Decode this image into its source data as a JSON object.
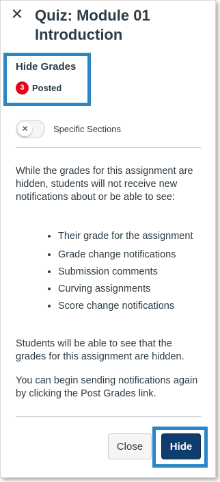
{
  "header": {
    "close_icon": "✕",
    "title": "Quiz: Module 01 Introduction"
  },
  "hide_grades": {
    "title": "Hide Grades",
    "posted_count": "3",
    "posted_label": "Posted"
  },
  "toggle": {
    "knob_icon": "✕",
    "label": "Specific Sections",
    "enabled": false
  },
  "content": {
    "intro": "While the grades for this assignment are hidden, students will not receive new notifications about or be able to see:",
    "bullets": [
      "Their grade for the assignment",
      "Grade change notifications",
      "Submission comments",
      "Curving assignments",
      "Score change notifications"
    ],
    "para2": "Students will be able to see that the grades for this assignment are hidden.",
    "para3": "You can begin sending notifications again by clicking the Post Grades link."
  },
  "footer": {
    "close_label": "Close",
    "hide_label": "Hide"
  },
  "colors": {
    "highlight": "#2b86c5",
    "badge": "#e0061f",
    "primary_button": "#0e3d6e",
    "text": "#2d3b45"
  }
}
